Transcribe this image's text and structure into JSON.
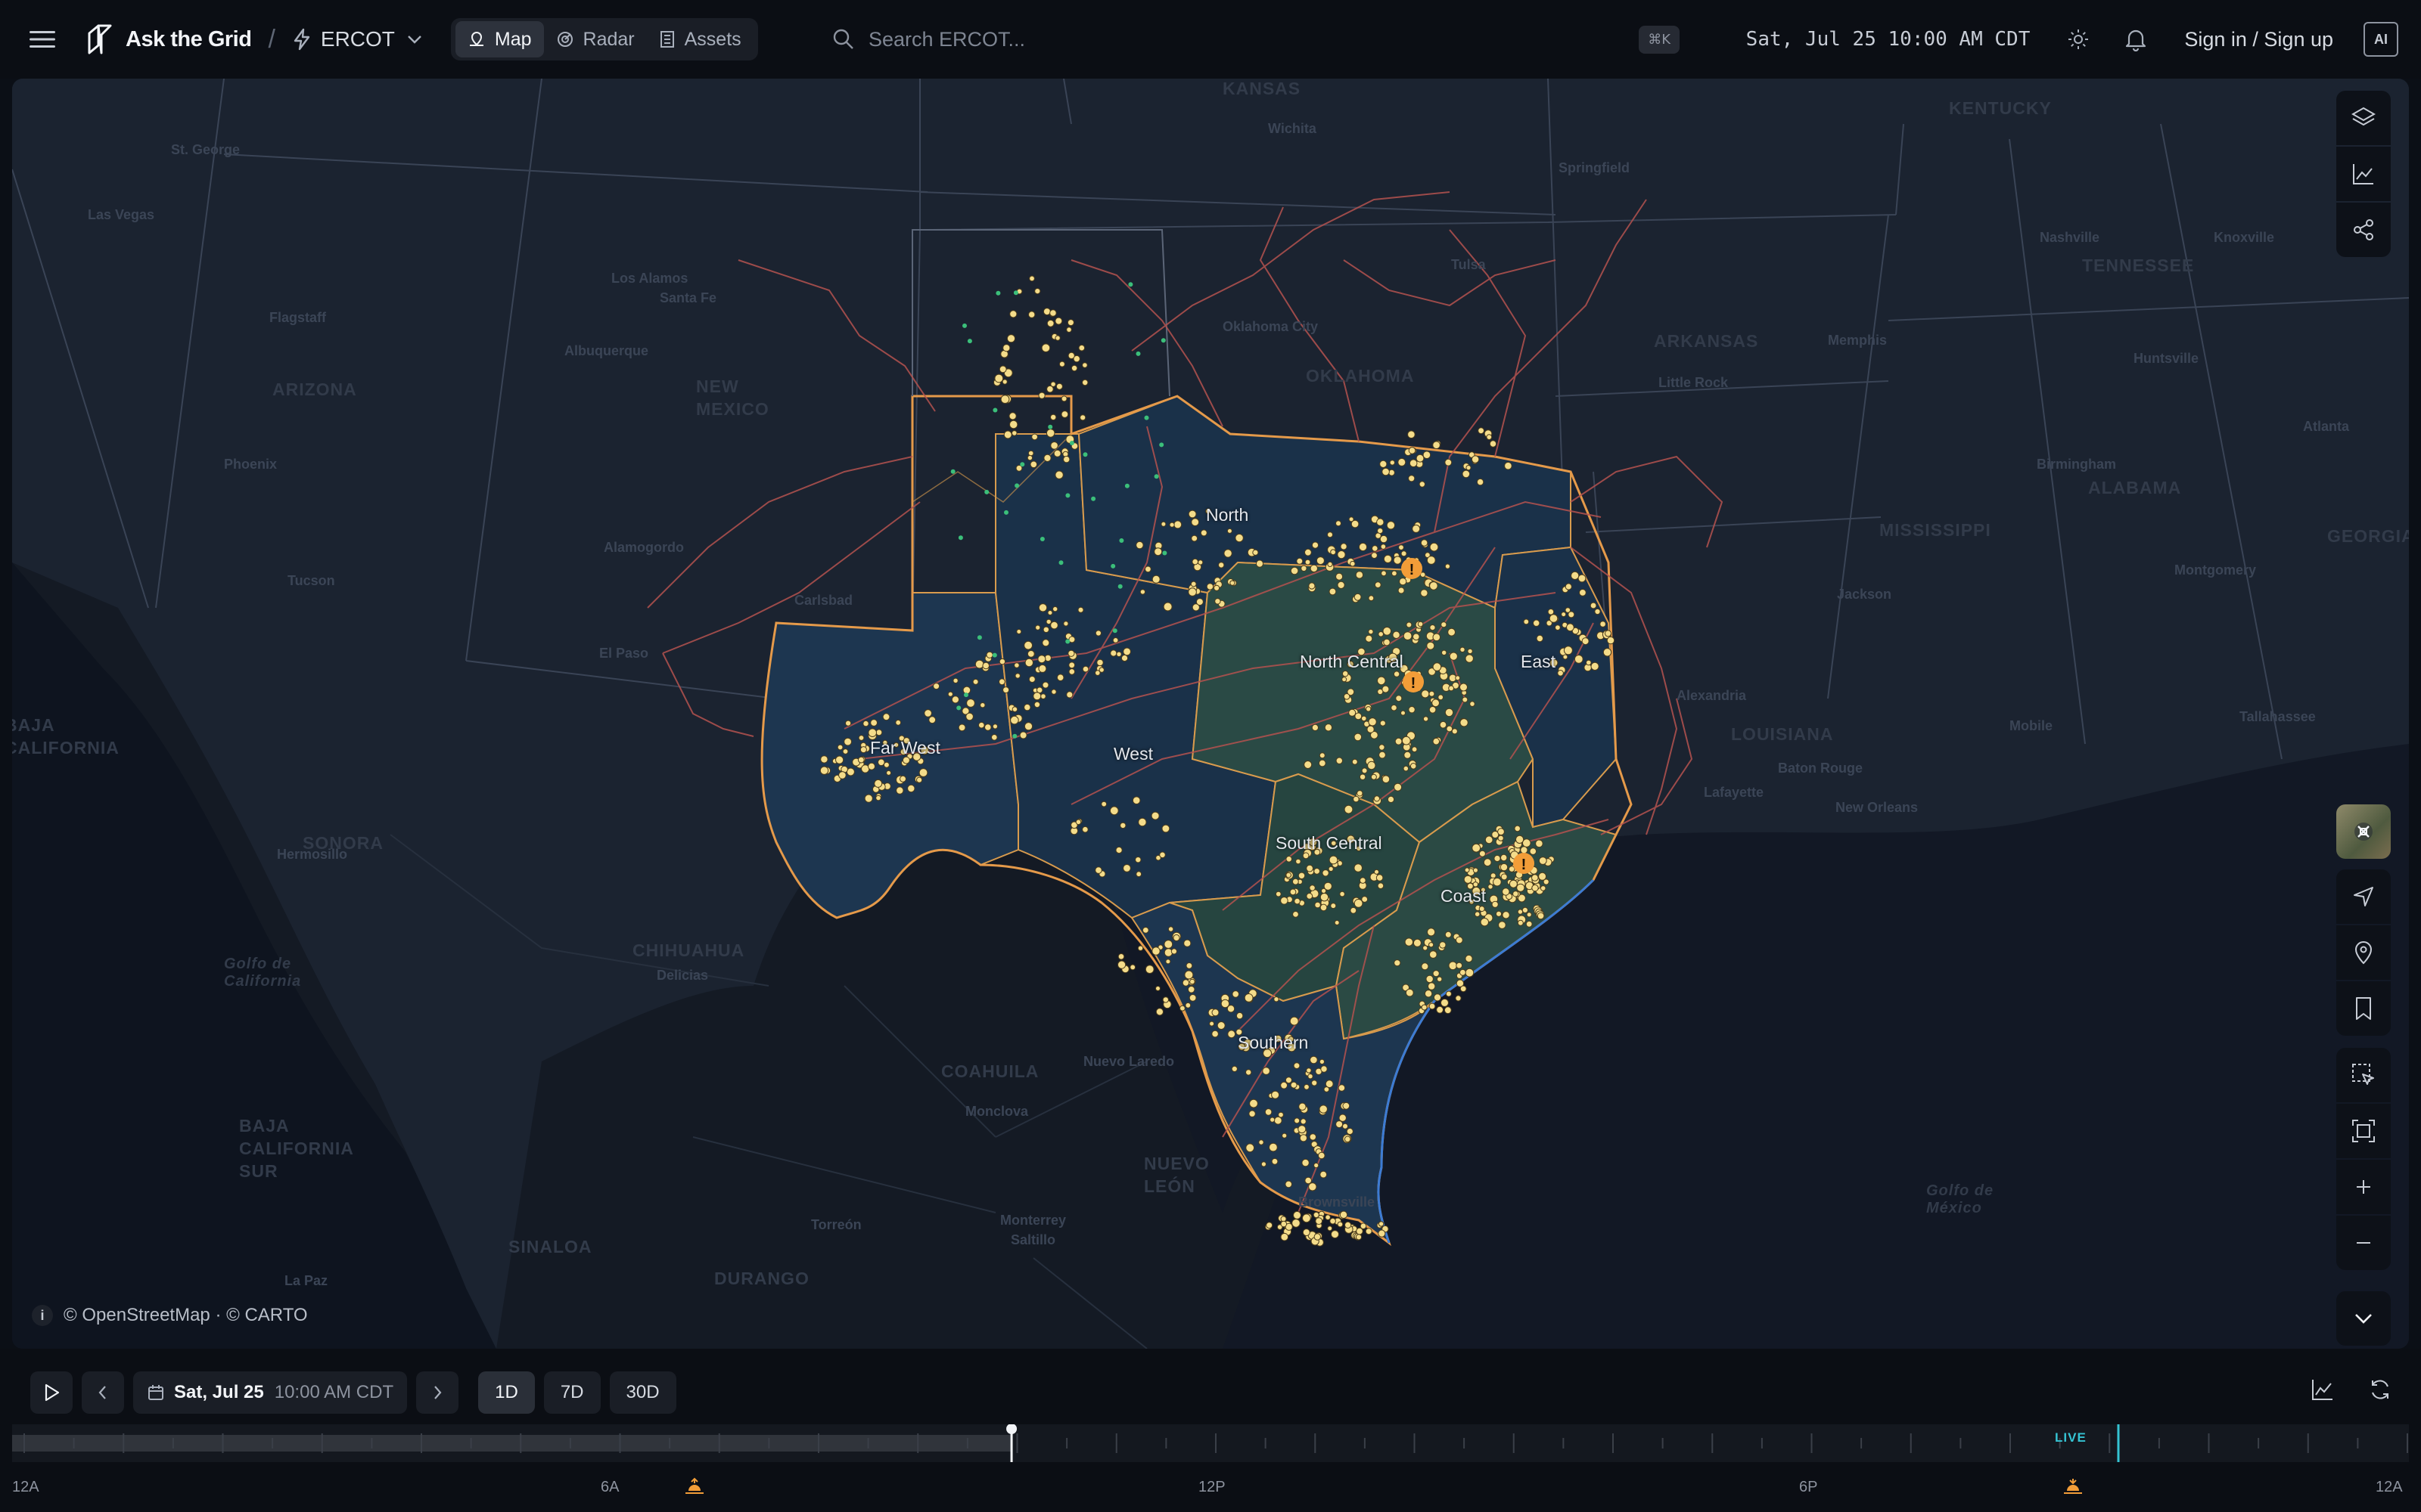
{
  "header": {
    "brand": "Ask the Grid",
    "separator": "/",
    "market": "ERCOT",
    "tabs": [
      {
        "label": "Map",
        "active": true
      },
      {
        "label": "Radar",
        "active": false
      },
      {
        "label": "Assets",
        "active": false
      }
    ],
    "search_placeholder": "Search ERCOT...",
    "search_shortcut": "⌘K",
    "datetime": "Sat, Jul 25 10:00 AM CDT",
    "signin": "Sign in / Sign up",
    "ai_label": "AI"
  },
  "map": {
    "regions": [
      "North",
      "North Central",
      "East",
      "Far West",
      "West",
      "South Central",
      "Coast",
      "Southern"
    ],
    "states": [
      "KANSAS",
      "KENTUCKY",
      "ARIZONA",
      "NEW MEXICO",
      "OKLAHOMA",
      "ARKANSAS",
      "TENNESSEE",
      "MISSISSIPPI",
      "ALABAMA",
      "GEORGIA",
      "LOUISIANA",
      "SONORA",
      "CHIHUAHUA",
      "COAHUILA",
      "NUEVO LEÓN",
      "DURANGO",
      "SINALOA",
      "BAJA CALIFORNIA SUR",
      "BAJA CALIFORNIA",
      "Golfo de California",
      "Golfo de México"
    ],
    "cities": [
      "Wichita",
      "Springfield",
      "Nashville",
      "Knoxville",
      "St. George",
      "Las Vegas",
      "Flagstaff",
      "Albuquerque",
      "Los Alamos",
      "Santa Fe",
      "Phoenix",
      "Tucson",
      "Alamogordo",
      "Carlsbad",
      "El Paso",
      "Tulsa",
      "Oklahoma City",
      "Little Rock",
      "Memphis",
      "Huntsville",
      "Birmingham",
      "Atlanta",
      "Montgomery",
      "Jackson",
      "Alexandria",
      "Baton Rouge",
      "Lafayette",
      "New Orleans",
      "Mobile",
      "Tallahassee",
      "Hermosillo",
      "Delicias",
      "Monclova",
      "Nuevo Laredo",
      "Brownsville",
      "Monterrey",
      "Saltillo",
      "Torreón",
      "La Paz"
    ],
    "attribution": "© OpenStreetMap · © CARTO",
    "alerts": 3
  },
  "timeline": {
    "date": "Sat, Jul 25",
    "time": "10:00 AM CDT",
    "ranges": [
      {
        "label": "1D",
        "active": true
      },
      {
        "label": "7D",
        "active": false
      },
      {
        "label": "30D",
        "active": false
      }
    ],
    "live_label": "LIVE",
    "hour_labels": [
      "12A",
      "6A",
      "12P",
      "6P",
      "12A"
    ],
    "progress": 0.417
  },
  "colors": {
    "accent_live": "#35c3d3",
    "asset_dot": "#f4dc8a",
    "alert": "#f29d38",
    "transmission": "#b4524f",
    "zone_border": "#e59a4a"
  }
}
